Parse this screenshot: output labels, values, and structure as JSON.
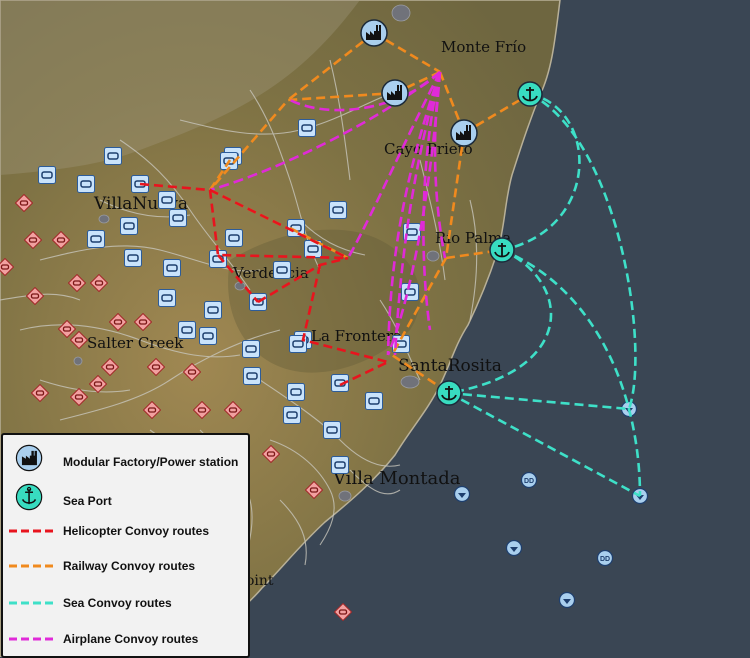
{
  "places": {
    "monte_frio": "Monte Frío",
    "cayo_prieto": "Cayo Prieto",
    "villanueva": "VillaNueva",
    "rio_palma": "Río Palma",
    "verdencia": "Verdencia",
    "salter_creek": "Salter Creek",
    "la_frontera": "La Frontera",
    "santarosita": "SantaRosita",
    "villa_montada": "Villa Montada",
    "point": "oint"
  },
  "naval_marker_label": "DD",
  "legend": {
    "factory": "Modular Factory/Power station",
    "seaport": "Sea Port",
    "heli": "Helicopter Convoy routes",
    "rail": "Railway Convoy routes",
    "sea": "Sea Convoy routes",
    "air": "Airplane Convoy routes"
  },
  "colors": {
    "heli": "#e8141e",
    "rail": "#f08a1e",
    "sea": "#3ee0c8",
    "air": "#e02ad8",
    "factory_fill": "#a9cfee",
    "seaport_fill": "#38dcc0",
    "ocean": "#3a4654",
    "land": "#8c7a4e"
  },
  "icons": {
    "factory": "factory-icon",
    "seaport": "anchor-icon",
    "blue_base": "base-marker-icon",
    "red_base": "enemy-marker-icon",
    "naval": "ship-marker-icon"
  }
}
